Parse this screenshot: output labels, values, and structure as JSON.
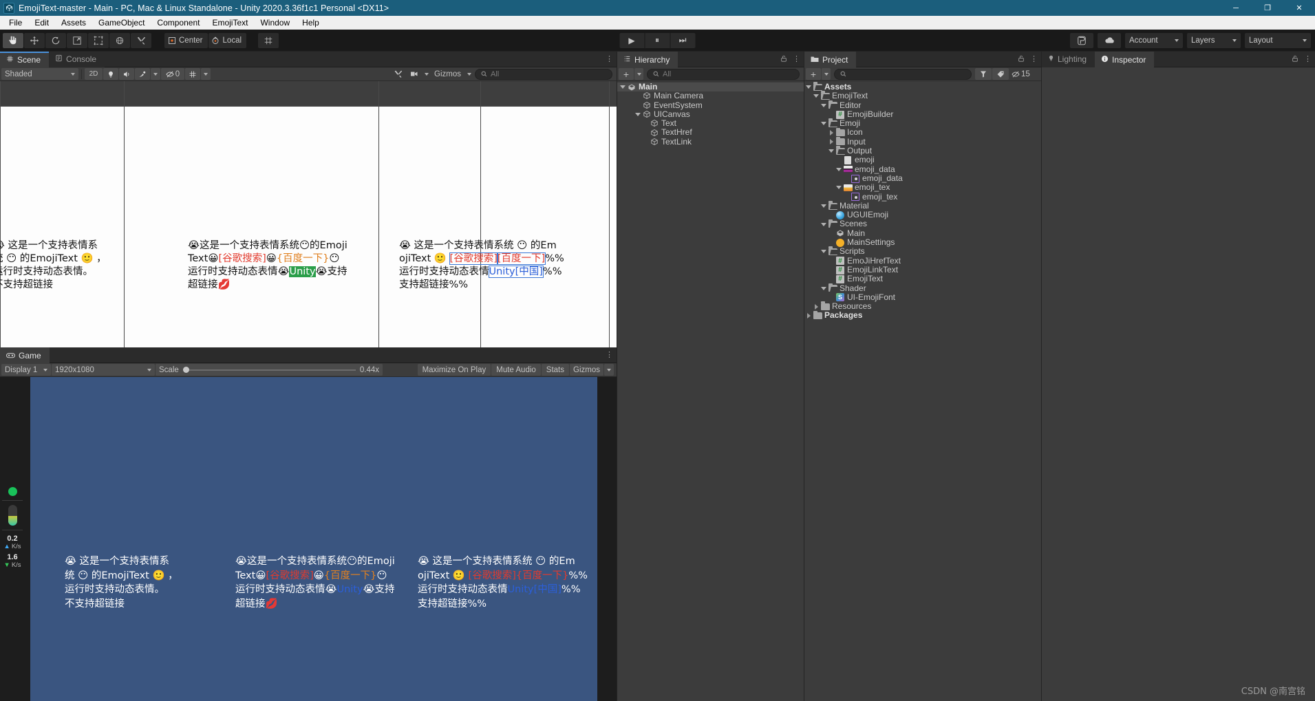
{
  "window": {
    "title": "EmojiText-master - Main - PC, Mac & Linux Standalone - Unity 2020.3.36f1c1 Personal <DX11>",
    "app_icon": "unity-icon",
    "controls": {
      "minimize": "─",
      "maximize": "❐",
      "close": "✕"
    }
  },
  "menubar": {
    "items": [
      "File",
      "Edit",
      "Assets",
      "GameObject",
      "Component",
      "EmojiText",
      "Window",
      "Help"
    ]
  },
  "toolbar": {
    "tools": [
      {
        "name": "hand-tool",
        "active": true
      },
      {
        "name": "move-tool",
        "active": false
      },
      {
        "name": "rotate-tool",
        "active": false
      },
      {
        "name": "scale-tool",
        "active": false
      },
      {
        "name": "rect-tool",
        "active": false
      },
      {
        "name": "transform-tool",
        "active": false
      },
      {
        "name": "custom-tool",
        "active": false
      }
    ],
    "pivot_label": "Center",
    "handle_label": "Local",
    "grid_snap": "grid-snap-icon",
    "play": "▶",
    "pause": "⏸",
    "step": "⏭",
    "collab": "collab-icon",
    "cloud": "cloud-icon",
    "account": "Account",
    "layers": "Layers",
    "layout": "Layout"
  },
  "scene_panel": {
    "tabs": [
      {
        "label": "Scene",
        "icon": "scene-grid-icon",
        "active": true
      },
      {
        "label": "Console",
        "icon": "console-icon",
        "active": false
      }
    ],
    "shading_mode": "Shaded",
    "mode_2d": "2D",
    "lighting_toggle": "lightbulb-icon",
    "audio_toggle": "audio-icon",
    "fx_toggle": "fx-icon",
    "hidden_count": "0",
    "grid_toggle": "grid-visibility-icon",
    "tools_icon": "scene-tools-icon",
    "camera_icon": "scene-camera-icon",
    "gizmos_label": "Gizmos",
    "search_placeholder": "All"
  },
  "scene_texts": [
    {
      "id": "scene-text-plain",
      "lines": [
        [
          {
            "t": "😭",
            "k": "em"
          },
          {
            "t": " 这是一个支持表情系",
            "k": "p"
          }
        ],
        [
          {
            "t": "统 ",
            "k": "p"
          },
          {
            "t": "😶",
            "k": "em"
          },
          {
            "t": " 的EmojiText ",
            "k": "p"
          },
          {
            "t": "🙂",
            "k": "em"
          },
          {
            "t": " ，",
            "k": "p"
          }
        ],
        [
          {
            "t": "运行时支持动态表情。",
            "k": "p"
          }
        ],
        [
          {
            "t": "不支持超链接",
            "k": "p"
          }
        ]
      ]
    },
    {
      "id": "scene-text-href",
      "lines": [
        [
          {
            "t": "😭",
            "k": "em"
          },
          {
            "t": "这是一个支持表情系统",
            "k": "p"
          },
          {
            "t": "😶",
            "k": "em"
          },
          {
            "t": "的Emoji",
            "k": "p"
          }
        ],
        [
          {
            "t": "Text",
            "k": "p"
          },
          {
            "t": "😀",
            "k": "em"
          },
          {
            "t": "[谷歌搜索]",
            "k": "red"
          },
          {
            "t": "😀",
            "k": "em"
          },
          {
            "t": "{百度一下}",
            "k": "orange"
          },
          {
            "t": "😶",
            "k": "em"
          }
        ],
        [
          {
            "t": "运行时支持动态表情",
            "k": "p"
          },
          {
            "t": "😭",
            "k": "em"
          },
          {
            "t": "Unity",
            "k": "link"
          },
          {
            "t": "😭",
            "k": "em"
          },
          {
            "t": "支持",
            "k": "p"
          }
        ],
        [
          {
            "t": "超链接",
            "k": "p"
          },
          {
            "t": "💋",
            "k": "em"
          }
        ]
      ]
    },
    {
      "id": "scene-text-link",
      "lines": [
        [
          {
            "t": "😭",
            "k": "em"
          },
          {
            "t": " 这是一个支持表情系统 ",
            "k": "p"
          },
          {
            "t": "😶",
            "k": "em"
          },
          {
            "t": " 的Em",
            "k": "p"
          }
        ],
        [
          {
            "t": "ojiText ",
            "k": "p"
          },
          {
            "t": "🙂",
            "k": "em"
          },
          {
            "t": " [谷歌搜索]",
            "k": "redbox"
          },
          {
            "t": "[百度一下]",
            "k": "redbox2"
          },
          {
            "t": "%%",
            "k": "p"
          }
        ],
        [
          {
            "t": "运行时支持动态表情",
            "k": "p"
          },
          {
            "t": "Unity[中国]",
            "k": "linkbox"
          },
          {
            "t": "%%",
            "k": "p"
          }
        ],
        [
          {
            "t": "支持超链接%%",
            "k": "p"
          }
        ]
      ]
    }
  ],
  "game_panel": {
    "tab_label": "Game",
    "tab_icon": "game-icon",
    "display": "Display 1",
    "resolution": "1920x1080",
    "scale_label": "Scale",
    "scale_value": "0.44x",
    "maximize_on_play": "Maximize On Play",
    "mute_audio": "Mute Audio",
    "stats": "Stats",
    "gizmos": "Gizmos"
  },
  "game_texts": [
    {
      "id": "game-text-plain",
      "lines": [
        [
          {
            "t": "😭",
            "k": "em"
          },
          {
            "t": " 这是一个支持表情系",
            "k": "p"
          }
        ],
        [
          {
            "t": "统 ",
            "k": "p"
          },
          {
            "t": "😶",
            "k": "em"
          },
          {
            "t": " 的EmojiText ",
            "k": "p"
          },
          {
            "t": "🙂",
            "k": "em"
          },
          {
            "t": " ，",
            "k": "p"
          }
        ],
        [
          {
            "t": "运行时支持动态表情。",
            "k": "p"
          }
        ],
        [
          {
            "t": "不支持超链接",
            "k": "p"
          }
        ]
      ]
    },
    {
      "id": "game-text-href",
      "lines": [
        [
          {
            "t": "😭",
            "k": "em"
          },
          {
            "t": "这是一个支持表情系统",
            "k": "p"
          },
          {
            "t": "😶",
            "k": "em"
          },
          {
            "t": "的Emoji",
            "k": "p"
          }
        ],
        [
          {
            "t": "Text",
            "k": "p"
          },
          {
            "t": "😀",
            "k": "em"
          },
          {
            "t": "[谷歌搜索]",
            "k": "red"
          },
          {
            "t": "😀",
            "k": "em"
          },
          {
            "t": "{百度一下}",
            "k": "orange"
          },
          {
            "t": "😶",
            "k": "em"
          }
        ],
        [
          {
            "t": "运行时支持动态表情",
            "k": "p"
          },
          {
            "t": "😭",
            "k": "em"
          },
          {
            "t": "Unity",
            "k": "link"
          },
          {
            "t": "😭",
            "k": "em"
          },
          {
            "t": "支持",
            "k": "p"
          }
        ],
        [
          {
            "t": "超链接",
            "k": "p"
          },
          {
            "t": "💋",
            "k": "em"
          }
        ]
      ]
    },
    {
      "id": "game-text-link",
      "lines": [
        [
          {
            "t": "😭",
            "k": "em"
          },
          {
            "t": " 这是一个支持表情系统 ",
            "k": "p"
          },
          {
            "t": "😶",
            "k": "em"
          },
          {
            "t": " 的Em",
            "k": "p"
          }
        ],
        [
          {
            "t": "ojiText ",
            "k": "p"
          },
          {
            "t": "🙂",
            "k": "em"
          },
          {
            "t": " [谷歌搜索]",
            "k": "red"
          },
          {
            "t": "{百度一下}",
            "k": "red"
          },
          {
            "t": "%%",
            "k": "p"
          }
        ],
        [
          {
            "t": "运行时支持动态表情",
            "k": "p"
          },
          {
            "t": "Unity[中国]",
            "k": "link"
          },
          {
            "t": "%%",
            "k": "p"
          }
        ],
        [
          {
            "t": "支持超链接%%",
            "k": "p"
          }
        ]
      ]
    }
  ],
  "game_stats": {
    "connection_dot": "green-status-dot",
    "battery": "battery-indicator",
    "upload_value": "0.2",
    "upload_unit": "K/s",
    "download_value": "1.6",
    "download_unit": "K/s"
  },
  "hierarchy": {
    "tab_label": "Hierarchy",
    "tab_icon": "hierarchy-icon",
    "add_label": "+",
    "search_placeholder": "All",
    "lock_icon": "lock-icon",
    "menu_icon": "kebab-menu-icon",
    "items": [
      {
        "label": "Main",
        "depth": 0,
        "icon": "scene-icon",
        "twisty": "open",
        "selected": true,
        "bold": true
      },
      {
        "label": "Main Camera",
        "depth": 2,
        "icon": "gameobject-icon",
        "twisty": "none"
      },
      {
        "label": "EventSystem",
        "depth": 2,
        "icon": "gameobject-icon",
        "twisty": "none"
      },
      {
        "label": "UICanvas",
        "depth": 2,
        "icon": "gameobject-icon",
        "twisty": "open"
      },
      {
        "label": "Text",
        "depth": 3,
        "icon": "gameobject-icon",
        "twisty": "none"
      },
      {
        "label": "TextHref",
        "depth": 3,
        "icon": "gameobject-icon",
        "twisty": "none"
      },
      {
        "label": "TextLink",
        "depth": 3,
        "icon": "gameobject-icon",
        "twisty": "none"
      }
    ]
  },
  "project": {
    "tab_label": "Project",
    "tab_icon": "project-folder-icon",
    "add_label": "+",
    "search_placeholder": "",
    "search_icon": "search-icon",
    "filter_type_icon": "filter-by-type-icon",
    "filter_label_icon": "filter-by-label-icon",
    "hidden_icon": "hidden-packages-icon",
    "hidden_count": "15",
    "lock_icon": "lock-icon",
    "menu_icon": "kebab-menu-icon",
    "items": [
      {
        "label": "Assets",
        "depth": 0,
        "icon": "folder-open-icon",
        "twisty": "open",
        "bold": true
      },
      {
        "label": "EmojiText",
        "depth": 1,
        "icon": "folder-open-icon",
        "twisty": "open"
      },
      {
        "label": "Editor",
        "depth": 2,
        "icon": "folder-open-icon",
        "twisty": "open"
      },
      {
        "label": "EmojiBuilder",
        "depth": 3,
        "icon": "csharp-script-icon",
        "twisty": "none"
      },
      {
        "label": "Emoji",
        "depth": 2,
        "icon": "folder-open-icon",
        "twisty": "open"
      },
      {
        "label": "Icon",
        "depth": 3,
        "icon": "folder-icon",
        "twisty": "closed"
      },
      {
        "label": "Input",
        "depth": 3,
        "icon": "folder-icon",
        "twisty": "closed"
      },
      {
        "label": "Output",
        "depth": 3,
        "icon": "folder-open-icon",
        "twisty": "open"
      },
      {
        "label": "emoji",
        "depth": 4,
        "icon": "text-asset-icon",
        "twisty": "none"
      },
      {
        "label": "emoji_data",
        "depth": 4,
        "icon": "texture-data-icon",
        "twisty": "open"
      },
      {
        "label": "emoji_data",
        "depth": 5,
        "icon": "sprite-icon",
        "twisty": "none"
      },
      {
        "label": "emoji_tex",
        "depth": 4,
        "icon": "texture-icon",
        "twisty": "open"
      },
      {
        "label": "emoji_tex",
        "depth": 5,
        "icon": "sprite-icon",
        "twisty": "none"
      },
      {
        "label": "Material",
        "depth": 2,
        "icon": "folder-open-icon",
        "twisty": "open"
      },
      {
        "label": "UGUIEmoji",
        "depth": 3,
        "icon": "material-icon",
        "twisty": "none"
      },
      {
        "label": "Scenes",
        "depth": 2,
        "icon": "folder-open-icon",
        "twisty": "open"
      },
      {
        "label": "Main",
        "depth": 3,
        "icon": "scene-icon",
        "twisty": "none"
      },
      {
        "label": "MainSettings",
        "depth": 3,
        "icon": "lighting-settings-icon",
        "twisty": "none"
      },
      {
        "label": "Scripts",
        "depth": 2,
        "icon": "folder-open-icon",
        "twisty": "open"
      },
      {
        "label": "EmoJiHrefText",
        "depth": 3,
        "icon": "csharp-script-icon",
        "twisty": "none"
      },
      {
        "label": "EmojiLinkText",
        "depth": 3,
        "icon": "csharp-script-icon",
        "twisty": "none"
      },
      {
        "label": "EmojiText",
        "depth": 3,
        "icon": "csharp-script-icon",
        "twisty": "none"
      },
      {
        "label": "Shader",
        "depth": 2,
        "icon": "folder-open-icon",
        "twisty": "open"
      },
      {
        "label": "UI-EmojiFont",
        "depth": 3,
        "icon": "shader-icon",
        "twisty": "none"
      },
      {
        "label": "Resources",
        "depth": 1,
        "icon": "folder-icon",
        "twisty": "closed"
      },
      {
        "label": "Packages",
        "depth": 0,
        "icon": "folder-icon",
        "twisty": "closed",
        "bold": true
      }
    ]
  },
  "inspector": {
    "tabs": [
      {
        "label": "Lighting",
        "icon": "lightbulb-icon",
        "active": false
      },
      {
        "label": "Inspector",
        "icon": "info-icon",
        "active": true
      }
    ],
    "lock_icon": "lock-icon",
    "menu_icon": "kebab-menu-icon"
  },
  "watermark": "CSDN @南宫铭",
  "colors": {
    "title_bar": "#1b5e7c",
    "panel_bg": "#3c3c3c",
    "toolbar_bg": "#191919",
    "accent_blue": "#4a90d9",
    "game_bg": "#3a5580",
    "link": "#3b6fe0",
    "red_tag": "#e23b2e",
    "orange_tag": "#e08020"
  }
}
